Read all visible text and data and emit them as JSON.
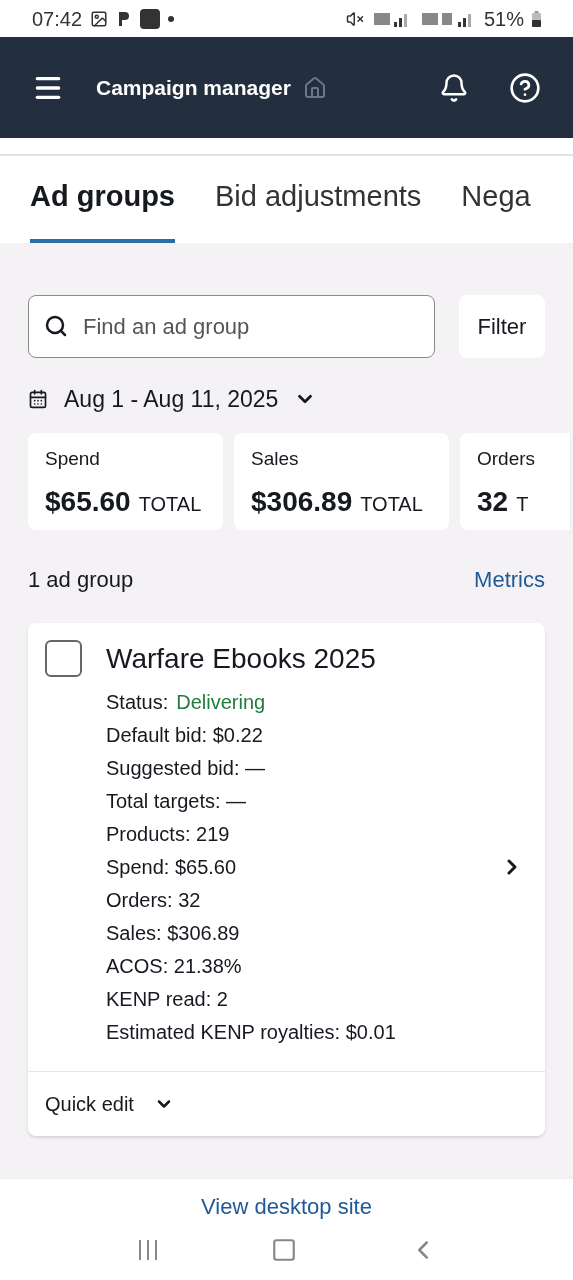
{
  "status_bar": {
    "time": "07:42",
    "battery": "51%"
  },
  "header": {
    "title": "Campaign manager"
  },
  "tabs": [
    {
      "label": "Ad groups",
      "selected": true
    },
    {
      "label": "Bid adjustments",
      "selected": false
    },
    {
      "label": "Nega",
      "selected": false
    }
  ],
  "search": {
    "placeholder": "Find an ad group"
  },
  "filter_button": "Filter",
  "date_range": "Aug 1 - Aug 11, 2025",
  "summary_cards": [
    {
      "label": "Spend",
      "value": "$65.60",
      "unit": "TOTAL"
    },
    {
      "label": "Sales",
      "value": "$306.89",
      "unit": "TOTAL"
    },
    {
      "label": "Orders",
      "value": "32",
      "unit": "T"
    }
  ],
  "count": "1 ad group",
  "metrics_link": "Metrics",
  "ad_group": {
    "name": "Warfare Ebooks 2025",
    "checked": false,
    "status": {
      "label": "Status:",
      "value": "Delivering"
    },
    "details": [
      "Default bid: $0.22",
      "Suggested bid: —",
      "Total targets: —",
      "Products: 219",
      "Spend: $65.60",
      "Orders: 32",
      "Sales: $306.89",
      "ACOS: 21.38%",
      "KENP read: 2",
      "Estimated KENP royalties: $0.01"
    ],
    "quick_edit": "Quick edit"
  },
  "footer_link": "View desktop site"
}
